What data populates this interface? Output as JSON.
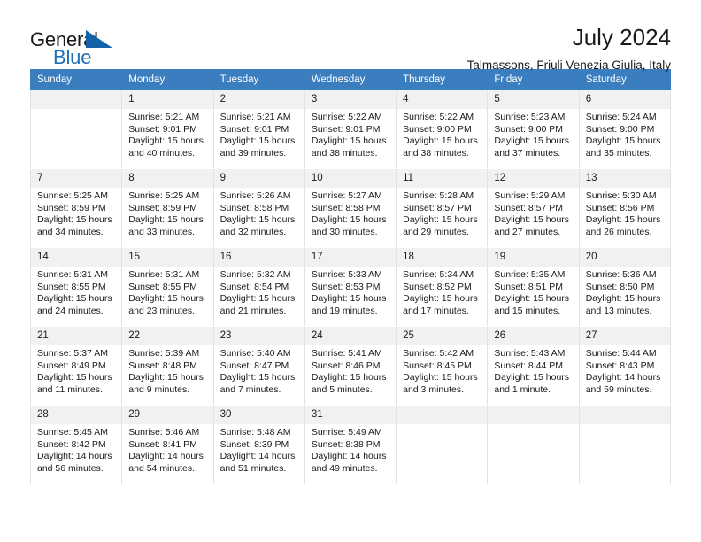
{
  "brand": {
    "word1": "General",
    "word2": "Blue",
    "triangle_icon": "triangle-icon",
    "accent_color": "#1463a8"
  },
  "header": {
    "title": "July 2024",
    "subtitle": "Talmassons, Friuli Venezia Giulia, Italy"
  },
  "calendar": {
    "header_color": "#3b7ec0",
    "weekday_headers": [
      "Sunday",
      "Monday",
      "Tuesday",
      "Wednesday",
      "Thursday",
      "Friday",
      "Saturday"
    ],
    "weeks": [
      [
        {
          "day": "",
          "lines": []
        },
        {
          "day": "1",
          "lines": [
            "Sunrise: 5:21 AM",
            "Sunset: 9:01 PM",
            "Daylight: 15 hours",
            "and 40 minutes."
          ]
        },
        {
          "day": "2",
          "lines": [
            "Sunrise: 5:21 AM",
            "Sunset: 9:01 PM",
            "Daylight: 15 hours",
            "and 39 minutes."
          ]
        },
        {
          "day": "3",
          "lines": [
            "Sunrise: 5:22 AM",
            "Sunset: 9:01 PM",
            "Daylight: 15 hours",
            "and 38 minutes."
          ]
        },
        {
          "day": "4",
          "lines": [
            "Sunrise: 5:22 AM",
            "Sunset: 9:00 PM",
            "Daylight: 15 hours",
            "and 38 minutes."
          ]
        },
        {
          "day": "5",
          "lines": [
            "Sunrise: 5:23 AM",
            "Sunset: 9:00 PM",
            "Daylight: 15 hours",
            "and 37 minutes."
          ]
        },
        {
          "day": "6",
          "lines": [
            "Sunrise: 5:24 AM",
            "Sunset: 9:00 PM",
            "Daylight: 15 hours",
            "and 35 minutes."
          ]
        }
      ],
      [
        {
          "day": "7",
          "lines": [
            "Sunrise: 5:25 AM",
            "Sunset: 8:59 PM",
            "Daylight: 15 hours",
            "and 34 minutes."
          ]
        },
        {
          "day": "8",
          "lines": [
            "Sunrise: 5:25 AM",
            "Sunset: 8:59 PM",
            "Daylight: 15 hours",
            "and 33 minutes."
          ]
        },
        {
          "day": "9",
          "lines": [
            "Sunrise: 5:26 AM",
            "Sunset: 8:58 PM",
            "Daylight: 15 hours",
            "and 32 minutes."
          ]
        },
        {
          "day": "10",
          "lines": [
            "Sunrise: 5:27 AM",
            "Sunset: 8:58 PM",
            "Daylight: 15 hours",
            "and 30 minutes."
          ]
        },
        {
          "day": "11",
          "lines": [
            "Sunrise: 5:28 AM",
            "Sunset: 8:57 PM",
            "Daylight: 15 hours",
            "and 29 minutes."
          ]
        },
        {
          "day": "12",
          "lines": [
            "Sunrise: 5:29 AM",
            "Sunset: 8:57 PM",
            "Daylight: 15 hours",
            "and 27 minutes."
          ]
        },
        {
          "day": "13",
          "lines": [
            "Sunrise: 5:30 AM",
            "Sunset: 8:56 PM",
            "Daylight: 15 hours",
            "and 26 minutes."
          ]
        }
      ],
      [
        {
          "day": "14",
          "lines": [
            "Sunrise: 5:31 AM",
            "Sunset: 8:55 PM",
            "Daylight: 15 hours",
            "and 24 minutes."
          ]
        },
        {
          "day": "15",
          "lines": [
            "Sunrise: 5:31 AM",
            "Sunset: 8:55 PM",
            "Daylight: 15 hours",
            "and 23 minutes."
          ]
        },
        {
          "day": "16",
          "lines": [
            "Sunrise: 5:32 AM",
            "Sunset: 8:54 PM",
            "Daylight: 15 hours",
            "and 21 minutes."
          ]
        },
        {
          "day": "17",
          "lines": [
            "Sunrise: 5:33 AM",
            "Sunset: 8:53 PM",
            "Daylight: 15 hours",
            "and 19 minutes."
          ]
        },
        {
          "day": "18",
          "lines": [
            "Sunrise: 5:34 AM",
            "Sunset: 8:52 PM",
            "Daylight: 15 hours",
            "and 17 minutes."
          ]
        },
        {
          "day": "19",
          "lines": [
            "Sunrise: 5:35 AM",
            "Sunset: 8:51 PM",
            "Daylight: 15 hours",
            "and 15 minutes."
          ]
        },
        {
          "day": "20",
          "lines": [
            "Sunrise: 5:36 AM",
            "Sunset: 8:50 PM",
            "Daylight: 15 hours",
            "and 13 minutes."
          ]
        }
      ],
      [
        {
          "day": "21",
          "lines": [
            "Sunrise: 5:37 AM",
            "Sunset: 8:49 PM",
            "Daylight: 15 hours",
            "and 11 minutes."
          ]
        },
        {
          "day": "22",
          "lines": [
            "Sunrise: 5:39 AM",
            "Sunset: 8:48 PM",
            "Daylight: 15 hours",
            "and 9 minutes."
          ]
        },
        {
          "day": "23",
          "lines": [
            "Sunrise: 5:40 AM",
            "Sunset: 8:47 PM",
            "Daylight: 15 hours",
            "and 7 minutes."
          ]
        },
        {
          "day": "24",
          "lines": [
            "Sunrise: 5:41 AM",
            "Sunset: 8:46 PM",
            "Daylight: 15 hours",
            "and 5 minutes."
          ]
        },
        {
          "day": "25",
          "lines": [
            "Sunrise: 5:42 AM",
            "Sunset: 8:45 PM",
            "Daylight: 15 hours",
            "and 3 minutes."
          ]
        },
        {
          "day": "26",
          "lines": [
            "Sunrise: 5:43 AM",
            "Sunset: 8:44 PM",
            "Daylight: 15 hours",
            "and 1 minute."
          ]
        },
        {
          "day": "27",
          "lines": [
            "Sunrise: 5:44 AM",
            "Sunset: 8:43 PM",
            "Daylight: 14 hours",
            "and 59 minutes."
          ]
        }
      ],
      [
        {
          "day": "28",
          "lines": [
            "Sunrise: 5:45 AM",
            "Sunset: 8:42 PM",
            "Daylight: 14 hours",
            "and 56 minutes."
          ]
        },
        {
          "day": "29",
          "lines": [
            "Sunrise: 5:46 AM",
            "Sunset: 8:41 PM",
            "Daylight: 14 hours",
            "and 54 minutes."
          ]
        },
        {
          "day": "30",
          "lines": [
            "Sunrise: 5:48 AM",
            "Sunset: 8:39 PM",
            "Daylight: 14 hours",
            "and 51 minutes."
          ]
        },
        {
          "day": "31",
          "lines": [
            "Sunrise: 5:49 AM",
            "Sunset: 8:38 PM",
            "Daylight: 14 hours",
            "and 49 minutes."
          ]
        },
        {
          "day": "",
          "lines": []
        },
        {
          "day": "",
          "lines": []
        },
        {
          "day": "",
          "lines": []
        }
      ]
    ]
  }
}
